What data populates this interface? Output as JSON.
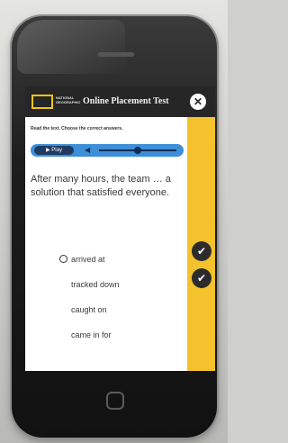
{
  "header": {
    "logo_text": "NATIONAL GEOGRAPHIC",
    "title": "Online Placement Test",
    "close_label": "✕"
  },
  "instruction": "Read the text. Choose the correct answers.",
  "audio": {
    "play_label": "▶ Play",
    "volume_level": 0.5
  },
  "question": {
    "text": "After many hours, the team … a solution that satisfied everyone."
  },
  "options": [
    {
      "label": "arrived at",
      "marker": true
    },
    {
      "label": "tracked down",
      "marker": false
    },
    {
      "label": "caught on",
      "marker": false
    },
    {
      "label": "came in for",
      "marker": false
    }
  ],
  "sidebar": {
    "check_label": "✔",
    "recheck_label": "✔"
  },
  "colors": {
    "accent_yellow": "#f3c22d",
    "header_dark": "#262626",
    "audio_blue": "#3c8fd8"
  }
}
